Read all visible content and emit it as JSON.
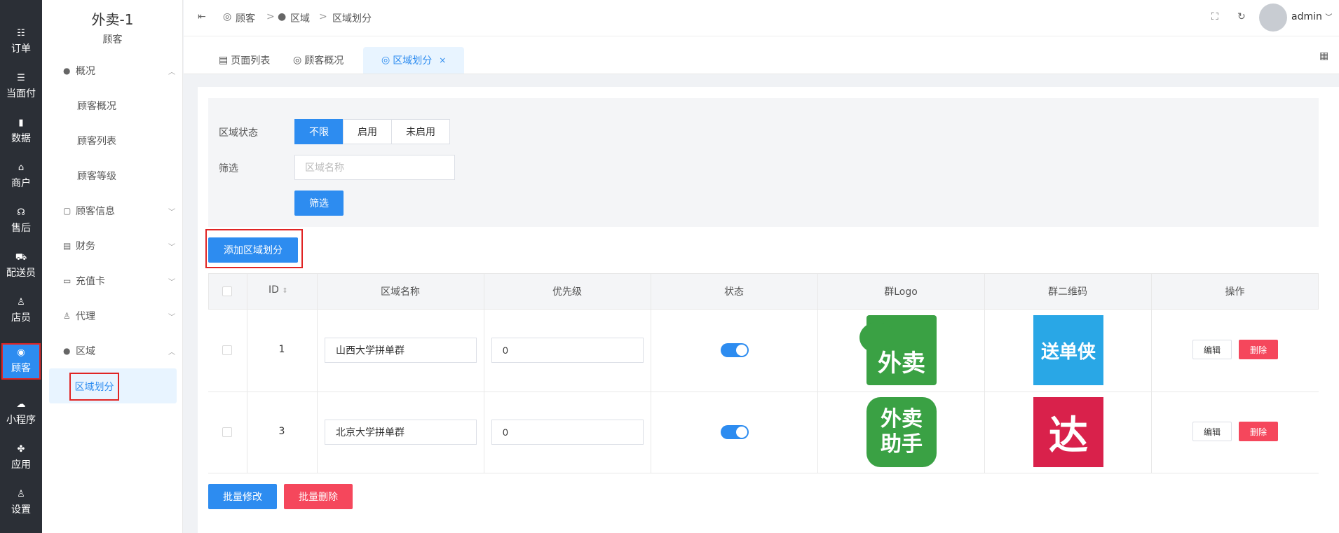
{
  "rail": [
    {
      "label": "订单",
      "icon": "list-icon",
      "glyph": "☷"
    },
    {
      "label": "当面付",
      "icon": "list-icon",
      "glyph": "☰"
    },
    {
      "label": "数据",
      "icon": "bar-chart-icon",
      "glyph": "▮"
    },
    {
      "label": "商户",
      "icon": "store-icon",
      "glyph": "⌂"
    },
    {
      "label": "售后",
      "icon": "headset-icon",
      "glyph": "☊"
    },
    {
      "label": "配送员",
      "icon": "truck-icon",
      "glyph": "⛟"
    },
    {
      "label": "店员",
      "icon": "user-icon",
      "glyph": "♙"
    },
    {
      "label": "顾客",
      "icon": "customer-icon",
      "glyph": "◉"
    },
    {
      "label": "小程序",
      "icon": "wechat-icon",
      "glyph": "☁"
    },
    {
      "label": "应用",
      "icon": "apps-icon",
      "glyph": "✤"
    },
    {
      "label": "设置",
      "icon": "settings-icon",
      "glyph": "♙"
    }
  ],
  "sidebar": {
    "title": "外卖-1",
    "subtitle": "顾客",
    "groups": [
      {
        "label": "概况",
        "glyph": "●",
        "chevron": "︿"
      },
      {
        "label": "顾客信息",
        "glyph": "▢",
        "chevron": "﹀"
      },
      {
        "label": "财务",
        "glyph": "▤",
        "chevron": "﹀"
      },
      {
        "label": "充值卡",
        "glyph": "▭",
        "chevron": "﹀"
      },
      {
        "label": "代理",
        "glyph": "♙",
        "chevron": "﹀"
      },
      {
        "label": "区域",
        "glyph": "●",
        "chevron": "︿"
      }
    ],
    "overview_items": [
      "顾客概况",
      "顾客列表",
      "顾客等级"
    ],
    "region_item": "区域划分"
  },
  "topbar": {
    "breadcrumb": [
      "顾客",
      ">",
      "区域",
      ">",
      "区域划分"
    ],
    "user": "admin"
  },
  "tabs": [
    {
      "label": "页面列表"
    },
    {
      "label": "顾客概况"
    },
    {
      "label": "区域划分",
      "close": "×"
    }
  ],
  "filter": {
    "status_label": "区域状态",
    "status_options": [
      "不限",
      "启用",
      "未启用"
    ],
    "status_selected": "不限",
    "search_label": "筛选",
    "search_placeholder": "区域名称",
    "search_button": "筛选"
  },
  "add_button": "添加区域划分",
  "table": {
    "columns": [
      "ID",
      "区域名称",
      "优先级",
      "状态",
      "群Logo",
      "群二维码",
      "操作"
    ],
    "rows": [
      {
        "id": "1",
        "name": "山西大学拼单群",
        "priority": "0",
        "enabled": true,
        "logo_text": "外卖",
        "qr_text": "送单侠",
        "edit": "编辑",
        "delete": "删除"
      },
      {
        "id": "3",
        "name": "北京大学拼单群",
        "priority": "0",
        "enabled": true,
        "logo_text": "外卖助手",
        "qr_text": "达",
        "edit": "编辑",
        "delete": "删除"
      }
    ]
  },
  "bulk": {
    "edit": "批量修改",
    "delete": "批量删除"
  },
  "colors": {
    "primary": "#2d8cf0",
    "danger": "#f5475c",
    "rail_bg": "#2b2f36",
    "logo_green": "#3aa144",
    "qr_blue": "#29a7e6",
    "qr_red": "#d9214b"
  }
}
